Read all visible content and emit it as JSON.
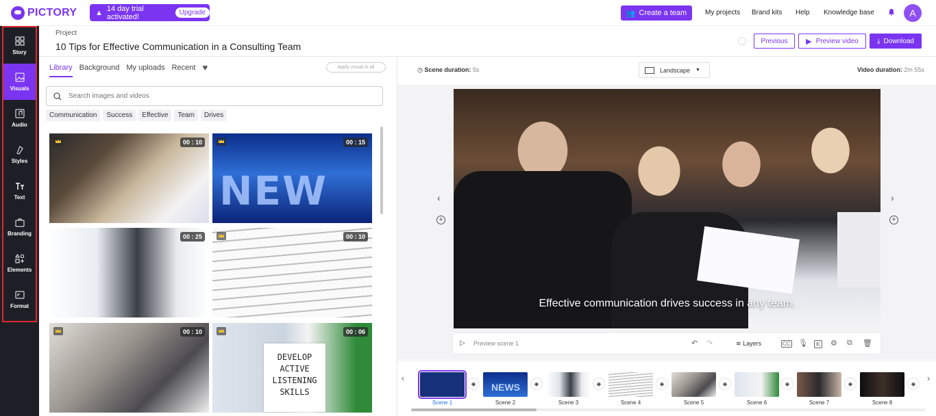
{
  "topbar": {
    "logo": "PICTORY",
    "trial_text": "14 day trial activated!",
    "upgrade_label": "Upgrade",
    "create_team": "Create a team",
    "nav": [
      "My projects",
      "Brand kits",
      "Help",
      "Knowledge base"
    ],
    "avatar_initial": "A",
    "brand_color": "#7b35f1"
  },
  "sidebar": {
    "items": [
      {
        "label": "Story",
        "icon": "story-icon"
      },
      {
        "label": "Visuals",
        "icon": "image-icon",
        "active": true
      },
      {
        "label": "Audio",
        "icon": "music-icon"
      },
      {
        "label": "Styles",
        "icon": "styles-icon"
      },
      {
        "label": "Text",
        "icon": "text-icon"
      },
      {
        "label": "Branding",
        "icon": "briefcase-icon"
      },
      {
        "label": "Elements",
        "icon": "shapes-icon"
      },
      {
        "label": "Format",
        "icon": "format-icon"
      }
    ]
  },
  "header": {
    "project_label": "Project",
    "title": "10 Tips for Effective Communication in a Consulting Team",
    "previous": "Previous",
    "preview": "Preview video",
    "download": "Download"
  },
  "library": {
    "tabs": [
      "Library",
      "Background",
      "My uploads",
      "Recent"
    ],
    "apply_all": "Apply visual to all",
    "search_placeholder": "Search images and videos",
    "chips": [
      "Communication",
      "Success",
      "Effective",
      "Team",
      "Drives"
    ],
    "thumbs": [
      {
        "duration": "00 : 10",
        "premium": true
      },
      {
        "duration": "00 : 15",
        "premium": true,
        "text": "NEW"
      },
      {
        "duration": "00 : 25",
        "premium": false
      },
      {
        "duration": "00 : 10",
        "premium": true
      },
      {
        "duration": "00 : 10",
        "premium": true
      },
      {
        "duration": "00 : 06",
        "premium": true,
        "text": "DEVELOP ACTIVE LISTENING SKILLS"
      }
    ]
  },
  "preview": {
    "scene_duration_label": "Scene duration:",
    "scene_duration": "5s",
    "orientation": "Landscape",
    "video_duration_label": "Video duration:",
    "video_duration": "2m 55s",
    "subtitle": "Effective communication drives success in any team.",
    "preview_scene": "Preview scene 1",
    "layers": "Layers"
  },
  "timeline": {
    "scenes": [
      "Scene 1",
      "Scene 2",
      "Scene 3",
      "Scene 4",
      "Scene 5",
      "Scene 6",
      "Scene 7",
      "Scene 8"
    ],
    "active_scene": "Scene 1",
    "scene_thumb_text": {
      "Scene 2": "NEWS"
    }
  }
}
